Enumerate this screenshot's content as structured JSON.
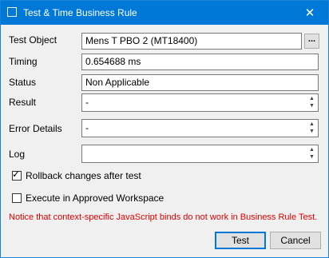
{
  "window": {
    "title": "Test & Time Business Rule",
    "close_glyph": "✕"
  },
  "fields": {
    "test_object": {
      "label": "Test Object",
      "value": "Mens T PBO 2 (MT18400)",
      "browse_label": "..."
    },
    "timing": {
      "label": "Timing",
      "value": "0.654688 ms"
    },
    "status": {
      "label": "Status",
      "value": "Non Applicable"
    },
    "result": {
      "label": "Result",
      "value": "-"
    },
    "error_details": {
      "label": "Error Details",
      "value": "-"
    },
    "log": {
      "label": "Log",
      "value": ""
    }
  },
  "options": {
    "rollback": {
      "label": "Rollback changes after test",
      "checked": true,
      "mark": "✓"
    },
    "approved_workspace": {
      "label": "Execute in Approved Workspace",
      "checked": false
    }
  },
  "notice": "Notice that context-specific JavaScript binds do not work in Business Rule Test.",
  "buttons": {
    "test": "Test",
    "cancel": "Cancel"
  },
  "colors": {
    "titlebar": "#0078d7",
    "notice": "#e00000"
  }
}
